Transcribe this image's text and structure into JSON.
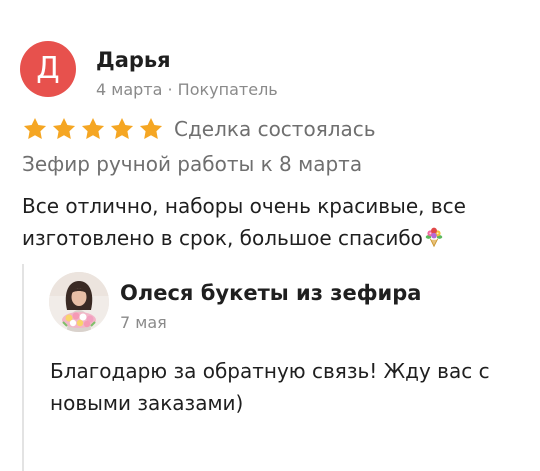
{
  "review": {
    "author": {
      "initial": "Д",
      "name": "Дарья",
      "meta": "4 марта · Покупатель",
      "avatar_color": "#e7514d"
    },
    "rating": {
      "stars": 5,
      "max": 5,
      "star_color": "#f5a623"
    },
    "deal_status": "Сделка состоялась",
    "product_title": "Зефир ручной работы к 8 марта",
    "text": "Все отлично, наборы очень красивые,  все изготовлено в срок, большое спасибо",
    "emoji": "bouquet-emoji"
  },
  "reply": {
    "seller_name": "Олеся букеты из зефира",
    "date": "7 мая",
    "text": "Благодарю за обратную связь! Жду вас с новыми заказами)"
  }
}
